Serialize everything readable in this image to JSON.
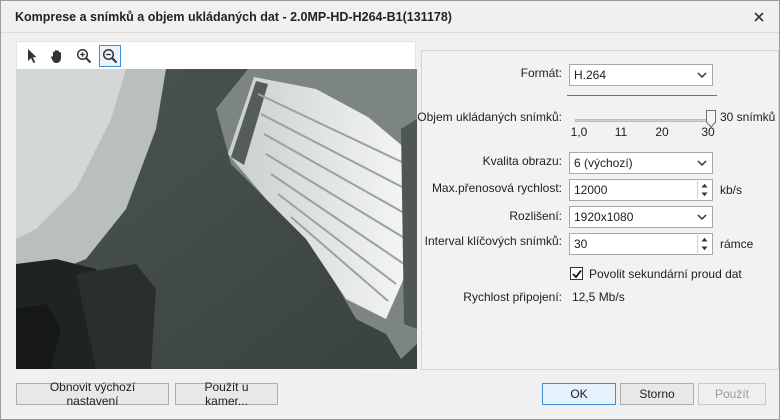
{
  "window": {
    "title": "Komprese a snímků a objem ukládaných dat - 2.0MP-HD-H264-B1(131178)"
  },
  "preview_toolbar": {
    "tools": [
      {
        "icon": "pointer-icon"
      },
      {
        "icon": "hand-icon"
      },
      {
        "icon": "zoom-in-icon"
      },
      {
        "icon": "zoom-out-icon",
        "active": true
      }
    ]
  },
  "settings": {
    "format": {
      "label": "Formát:",
      "value": "H.264"
    },
    "storage": {
      "label": "Objem ukládaných snímků:",
      "value_label": "30 snímků",
      "ticks": [
        "1,0",
        "11",
        "20",
        "30"
      ],
      "level": 30,
      "range": [
        1,
        30
      ]
    },
    "quality": {
      "label": "Kvalita obrazu:",
      "value": "6 (výchozí)"
    },
    "bitrate": {
      "label": "Max.přenosová rychlost:",
      "value": "12000",
      "unit": "kb/s"
    },
    "resolution": {
      "label": "Rozlišení:",
      "value": "1920x1080"
    },
    "keyframe": {
      "label": "Interval klíčových snímků:",
      "value": "30",
      "unit": "rámce"
    },
    "secondary_stream": {
      "label": "Povolit sekundární proud dat",
      "checked": true
    },
    "connection": {
      "label": "Rychlost připojení:",
      "value": "12,5 Mb/s"
    }
  },
  "buttons": {
    "reset": "Obnovit výchozí nastavení",
    "apply_camera": "Použít u kamer...",
    "ok": "OK",
    "cancel": "Storno",
    "apply": "Použít"
  }
}
